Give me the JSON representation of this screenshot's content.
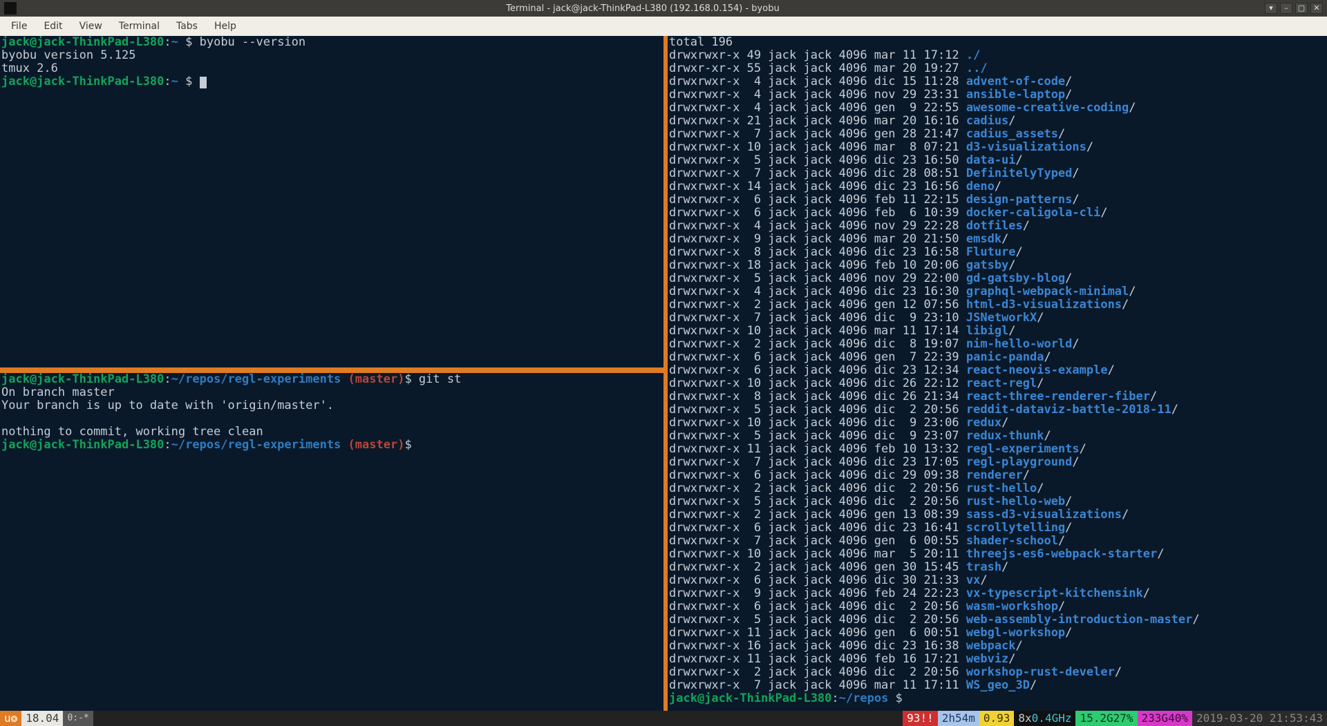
{
  "window": {
    "title": "Terminal - jack@jack-ThinkPad-L380 (192.168.0.154) - byobu",
    "btn_min": "–",
    "btn_max": "▢",
    "btn_close": "✕",
    "btn_shade": "▾"
  },
  "menubar": [
    "File",
    "Edit",
    "View",
    "Terminal",
    "Tabs",
    "Help"
  ],
  "pane_top": {
    "host": "jack@jack-ThinkPad-L380",
    "tilde": "~",
    "cmd1": "byobu --version",
    "out1": "byobu version 5.125",
    "out2": "tmux 2.6"
  },
  "pane_bottom": {
    "host": "jack@jack-ThinkPad-L380",
    "path": "~/repos/regl-experiments",
    "branch": "(master)",
    "cmd": "git st",
    "l1": "On branch master",
    "l2": "Your branch is up to date with 'origin/master'.",
    "l3": "",
    "l4": "nothing to commit, working tree clean"
  },
  "right": {
    "header": "total 196",
    "rows": [
      {
        "p": "drwxrwxr-x 49 jack jack 4096 mar 11 17:12 ",
        "d": "./"
      },
      {
        "p": "drwxr-xr-x 55 jack jack 4096 mar 20 19:27 ",
        "d": "../"
      },
      {
        "p": "drwxrwxr-x  4 jack jack 4096 dic 15 11:28 ",
        "n": "advent-of-code",
        "s": "/"
      },
      {
        "p": "drwxrwxr-x  4 jack jack 4096 nov 29 23:31 ",
        "n": "ansible-laptop",
        "s": "/"
      },
      {
        "p": "drwxrwxr-x  4 jack jack 4096 gen  9 22:55 ",
        "n": "awesome-creative-coding",
        "s": "/"
      },
      {
        "p": "drwxrwxr-x 21 jack jack 4096 mar 20 16:16 ",
        "n": "cadius",
        "s": "/"
      },
      {
        "p": "drwxrwxr-x  7 jack jack 4096 gen 28 21:47 ",
        "n": "cadius_assets",
        "s": "/"
      },
      {
        "p": "drwxrwxr-x 10 jack jack 4096 mar  8 07:21 ",
        "n": "d3-visualizations",
        "s": "/"
      },
      {
        "p": "drwxrwxr-x  5 jack jack 4096 dic 23 16:50 ",
        "n": "data-ui",
        "s": "/"
      },
      {
        "p": "drwxrwxr-x  7 jack jack 4096 dic 28 08:51 ",
        "n": "DefinitelyTyped",
        "s": "/"
      },
      {
        "p": "drwxrwxr-x 14 jack jack 4096 dic 23 16:56 ",
        "n": "deno",
        "s": "/"
      },
      {
        "p": "drwxrwxr-x  6 jack jack 4096 feb 11 22:15 ",
        "n": "design-patterns",
        "s": "/"
      },
      {
        "p": "drwxrwxr-x  6 jack jack 4096 feb  6 10:39 ",
        "n": "docker-caligola-cli",
        "s": "/"
      },
      {
        "p": "drwxrwxr-x  4 jack jack 4096 nov 29 22:28 ",
        "n": "dotfiles",
        "s": "/"
      },
      {
        "p": "drwxrwxr-x  9 jack jack 4096 mar 20 21:50 ",
        "n": "emsdk",
        "s": "/"
      },
      {
        "p": "drwxrwxr-x  8 jack jack 4096 dic 23 16:58 ",
        "n": "Fluture",
        "s": "/"
      },
      {
        "p": "drwxrwxr-x 18 jack jack 4096 feb 10 20:06 ",
        "n": "gatsby",
        "s": "/"
      },
      {
        "p": "drwxrwxr-x  5 jack jack 4096 nov 29 22:00 ",
        "n": "gd-gatsby-blog",
        "s": "/"
      },
      {
        "p": "drwxrwxr-x  4 jack jack 4096 dic 23 16:30 ",
        "n": "graphql-webpack-minimal",
        "s": "/"
      },
      {
        "p": "drwxrwxr-x  2 jack jack 4096 gen 12 07:56 ",
        "n": "html-d3-visualizations",
        "s": "/"
      },
      {
        "p": "drwxrwxr-x  7 jack jack 4096 dic  9 23:10 ",
        "n": "JSNetworkX",
        "s": "/"
      },
      {
        "p": "drwxrwxr-x 10 jack jack 4096 mar 11 17:14 ",
        "n": "libigl",
        "s": "/"
      },
      {
        "p": "drwxrwxr-x  2 jack jack 4096 dic  8 19:07 ",
        "n": "nim-hello-world",
        "s": "/"
      },
      {
        "p": "drwxrwxr-x  6 jack jack 4096 gen  7 22:39 ",
        "n": "panic-panda",
        "s": "/"
      },
      {
        "p": "drwxrwxr-x  6 jack jack 4096 dic 23 12:34 ",
        "n": "react-neovis-example",
        "s": "/"
      },
      {
        "p": "drwxrwxr-x 10 jack jack 4096 dic 26 22:12 ",
        "n": "react-regl",
        "s": "/"
      },
      {
        "p": "drwxrwxr-x  8 jack jack 4096 dic 26 21:34 ",
        "n": "react-three-renderer-fiber",
        "s": "/"
      },
      {
        "p": "drwxrwxr-x  5 jack jack 4096 dic  2 20:56 ",
        "n": "reddit-dataviz-battle-2018-11",
        "s": "/"
      },
      {
        "p": "drwxrwxr-x 10 jack jack 4096 dic  9 23:06 ",
        "n": "redux",
        "s": "/"
      },
      {
        "p": "drwxrwxr-x  5 jack jack 4096 dic  9 23:07 ",
        "n": "redux-thunk",
        "s": "/"
      },
      {
        "p": "drwxrwxr-x 11 jack jack 4096 feb 10 13:32 ",
        "n": "regl-experiments",
        "s": "/"
      },
      {
        "p": "drwxrwxr-x  7 jack jack 4096 dic 23 17:05 ",
        "n": "regl-playground",
        "s": "/"
      },
      {
        "p": "drwxrwxr-x  6 jack jack 4096 dic 29 09:38 ",
        "n": "renderer",
        "s": "/"
      },
      {
        "p": "drwxrwxr-x  2 jack jack 4096 dic  2 20:56 ",
        "n": "rust-hello",
        "s": "/"
      },
      {
        "p": "drwxrwxr-x  5 jack jack 4096 dic  2 20:56 ",
        "n": "rust-hello-web",
        "s": "/"
      },
      {
        "p": "drwxrwxr-x  2 jack jack 4096 gen 13 08:39 ",
        "n": "sass-d3-visualizations",
        "s": "/"
      },
      {
        "p": "drwxrwxr-x  6 jack jack 4096 dic 23 16:41 ",
        "n": "scrollytelling",
        "s": "/"
      },
      {
        "p": "drwxrwxr-x  7 jack jack 4096 gen  6 00:55 ",
        "n": "shader-school",
        "s": "/"
      },
      {
        "p": "drwxrwxr-x 10 jack jack 4096 mar  5 20:11 ",
        "n": "threejs-es6-webpack-starter",
        "s": "/"
      },
      {
        "p": "drwxrwxr-x  2 jack jack 4096 gen 30 15:45 ",
        "n": "trash",
        "s": "/"
      },
      {
        "p": "drwxrwxr-x  6 jack jack 4096 dic 30 21:33 ",
        "n": "vx",
        "s": "/"
      },
      {
        "p": "drwxrwxr-x  9 jack jack 4096 feb 24 22:23 ",
        "n": "vx-typescript-kitchensink",
        "s": "/"
      },
      {
        "p": "drwxrwxr-x  6 jack jack 4096 dic  2 20:56 ",
        "n": "wasm-workshop",
        "s": "/"
      },
      {
        "p": "drwxrwxr-x  5 jack jack 4096 dic  2 20:56 ",
        "n": "web-assembly-introduction-master",
        "s": "/"
      },
      {
        "p": "drwxrwxr-x 11 jack jack 4096 gen  6 00:51 ",
        "n": "webgl-workshop",
        "s": "/"
      },
      {
        "p": "drwxrwxr-x 16 jack jack 4096 dic 23 16:38 ",
        "n": "webpack",
        "s": "/"
      },
      {
        "p": "drwxrwxr-x 11 jack jack 4096 feb 16 17:21 ",
        "n": "webviz",
        "s": "/"
      },
      {
        "p": "drwxrwxr-x  2 jack jack 4096 dic  2 20:56 ",
        "n": "workshop-rust-develer",
        "s": "/"
      },
      {
        "p": "drwxrwxr-x  7 jack jack 4096 mar 11 17:11 ",
        "n": "WS_geo_3D",
        "s": "/"
      }
    ],
    "prompt_host": "jack@jack-ThinkPad-L380",
    "prompt_path": "~/repos"
  },
  "status": {
    "logo": "u❂",
    "distro": "18.04",
    "session": "0:-*",
    "alert": "93!!",
    "uptime": "2h54m",
    "load": "0.93",
    "cpu_n": "8x",
    "cpu_f": "0.4GHz",
    "mem": "15.2G27%",
    "disk": "233G40%",
    "date": "2019-03-20 21:53:43"
  }
}
